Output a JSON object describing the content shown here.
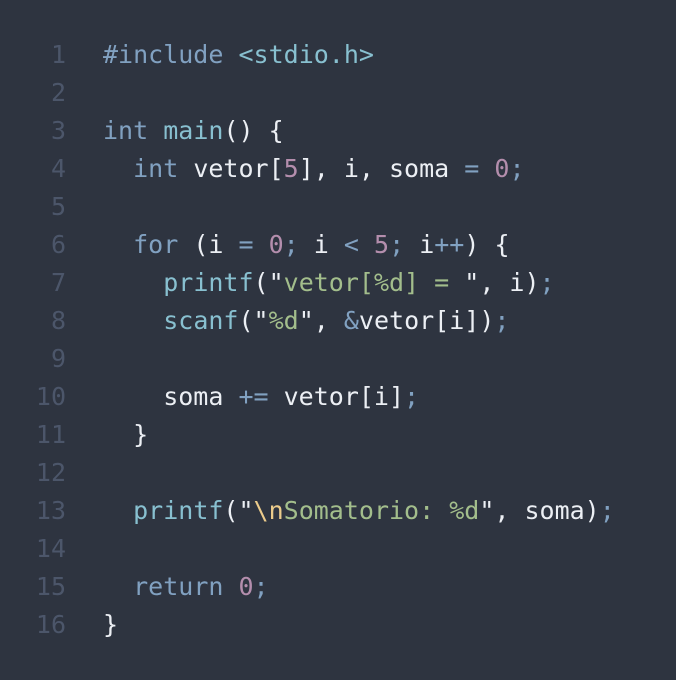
{
  "colors": {
    "background": "#2e3440",
    "line_number": "#4c566a",
    "keyword": "#81a1c1",
    "function": "#88c0d0",
    "string": "#a3be8c",
    "number": "#b48ead",
    "escape": "#ebcb8b",
    "text": "#eceff4"
  },
  "lines": [
    {
      "n": "1",
      "tokens": [
        {
          "t": "kw",
          "v": "#include"
        },
        {
          "t": "txt",
          "v": " "
        },
        {
          "t": "fn",
          "v": "<stdio.h>"
        }
      ]
    },
    {
      "n": "2",
      "tokens": []
    },
    {
      "n": "3",
      "tokens": [
        {
          "t": "kw",
          "v": "int"
        },
        {
          "t": "txt",
          "v": " "
        },
        {
          "t": "fn",
          "v": "main"
        },
        {
          "t": "txt",
          "v": "() {"
        }
      ]
    },
    {
      "n": "4",
      "tokens": [
        {
          "t": "txt",
          "v": "  "
        },
        {
          "t": "kw",
          "v": "int"
        },
        {
          "t": "txt",
          "v": " vetor["
        },
        {
          "t": "num",
          "v": "5"
        },
        {
          "t": "txt",
          "v": "], i, soma "
        },
        {
          "t": "op",
          "v": "="
        },
        {
          "t": "txt",
          "v": " "
        },
        {
          "t": "num",
          "v": "0"
        },
        {
          "t": "punc",
          "v": ";"
        }
      ]
    },
    {
      "n": "5",
      "tokens": []
    },
    {
      "n": "6",
      "tokens": [
        {
          "t": "txt",
          "v": "  "
        },
        {
          "t": "kw",
          "v": "for"
        },
        {
          "t": "txt",
          "v": " (i "
        },
        {
          "t": "op",
          "v": "="
        },
        {
          "t": "txt",
          "v": " "
        },
        {
          "t": "num",
          "v": "0"
        },
        {
          "t": "punc",
          "v": ";"
        },
        {
          "t": "txt",
          "v": " i "
        },
        {
          "t": "op",
          "v": "<"
        },
        {
          "t": "txt",
          "v": " "
        },
        {
          "t": "num",
          "v": "5"
        },
        {
          "t": "punc",
          "v": ";"
        },
        {
          "t": "txt",
          "v": " i"
        },
        {
          "t": "op",
          "v": "++"
        },
        {
          "t": "txt",
          "v": ") {"
        }
      ]
    },
    {
      "n": "7",
      "tokens": [
        {
          "t": "txt",
          "v": "    "
        },
        {
          "t": "fn",
          "v": "printf"
        },
        {
          "t": "txt",
          "v": "(\""
        },
        {
          "t": "str",
          "v": "vetor[%d] = "
        },
        {
          "t": "txt",
          "v": "\", i)"
        },
        {
          "t": "punc",
          "v": ";"
        }
      ]
    },
    {
      "n": "8",
      "tokens": [
        {
          "t": "txt",
          "v": "    "
        },
        {
          "t": "fn",
          "v": "scanf"
        },
        {
          "t": "txt",
          "v": "(\""
        },
        {
          "t": "str",
          "v": "%d"
        },
        {
          "t": "txt",
          "v": "\", "
        },
        {
          "t": "op",
          "v": "&"
        },
        {
          "t": "txt",
          "v": "vetor[i])"
        },
        {
          "t": "punc",
          "v": ";"
        }
      ]
    },
    {
      "n": "9",
      "tokens": []
    },
    {
      "n": "10",
      "tokens": [
        {
          "t": "txt",
          "v": "    soma "
        },
        {
          "t": "op",
          "v": "+="
        },
        {
          "t": "txt",
          "v": " vetor[i]"
        },
        {
          "t": "punc",
          "v": ";"
        }
      ]
    },
    {
      "n": "11",
      "tokens": [
        {
          "t": "txt",
          "v": "  }"
        }
      ]
    },
    {
      "n": "12",
      "tokens": []
    },
    {
      "n": "13",
      "tokens": [
        {
          "t": "txt",
          "v": "  "
        },
        {
          "t": "fn",
          "v": "printf"
        },
        {
          "t": "txt",
          "v": "(\""
        },
        {
          "t": "esc",
          "v": "\\n"
        },
        {
          "t": "str",
          "v": "Somatorio: %d"
        },
        {
          "t": "txt",
          "v": "\", soma)"
        },
        {
          "t": "punc",
          "v": ";"
        }
      ]
    },
    {
      "n": "14",
      "tokens": []
    },
    {
      "n": "15",
      "tokens": [
        {
          "t": "txt",
          "v": "  "
        },
        {
          "t": "kw",
          "v": "return"
        },
        {
          "t": "txt",
          "v": " "
        },
        {
          "t": "num",
          "v": "0"
        },
        {
          "t": "punc",
          "v": ";"
        }
      ]
    },
    {
      "n": "16",
      "tokens": [
        {
          "t": "txt",
          "v": "}"
        }
      ]
    }
  ]
}
